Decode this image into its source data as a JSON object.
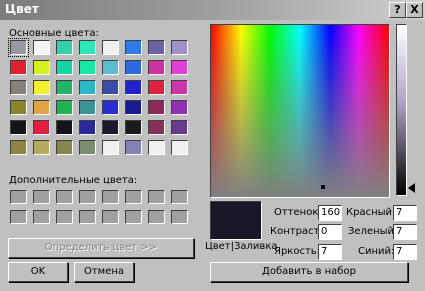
{
  "title": "Цвет",
  "help_btn": "?",
  "close_btn": "X",
  "basic_colors_label": "Основные цвета:",
  "basic_colors": [
    "#9a96a2",
    "#f4f4f4",
    "#36d0a8",
    "#2ce8b8",
    "#f0f0f0",
    "#2e7ae6",
    "#6a62a6",
    "#a090c8",
    "#e02030",
    "#d4f020",
    "#14d4a4",
    "#16e8a0",
    "#5cbcd2",
    "#2a6ade",
    "#d030a0",
    "#e040d6",
    "#86827a",
    "#f0f030",
    "#24b468",
    "#2cb8c8",
    "#3a4aa8",
    "#2222cc",
    "#e02040",
    "#c838a8",
    "#8c8428",
    "#e0a444",
    "#20b450",
    "#3a9498",
    "#2a2ed2",
    "#1a1a90",
    "#8c2a5a",
    "#9030b0",
    "#14141a",
    "#e02040",
    "#12121a",
    "#2a2a9a",
    "#1a1a2c",
    "#1a1a1a",
    "#86305a",
    "#6a3a8a",
    "#8e8640",
    "#b4aa60",
    "#86864c",
    "#7c8c70",
    "#f0f0f0",
    "#8282b6",
    "#f0f0f0",
    "#f0f0f0"
  ],
  "custom_colors_label": "Дополнительные цвета:",
  "custom_colors": [
    "#a0a0a0",
    "#a0a0a0",
    "#a0a0a0",
    "#a0a0a0",
    "#a0a0a0",
    "#a0a0a0",
    "#a0a0a0",
    "#a0a0a0",
    "#a0a0a0",
    "#a0a0a0",
    "#a0a0a0",
    "#a0a0a0",
    "#a0a0a0",
    "#a0a0a0",
    "#a0a0a0",
    "#a0a0a0"
  ],
  "define_btn": "Определить цвет >>",
  "ok_btn": "OK",
  "cancel_btn": "Отмена",
  "preview_label": "Цвет|Заливка",
  "preview_color": "#1a1628",
  "hue_label": "Оттенок:",
  "hue_value": "160",
  "sat_label": "Контраст:",
  "sat_value": "0",
  "lum_label": "Яркость:",
  "lum_value": "7",
  "red_label": "Красный:",
  "red_value": "7",
  "green_label": "Зеленый:",
  "green_value": "7",
  "blue_label": "Синий:",
  "blue_value": "7",
  "add_btn": "Добавить в набор"
}
